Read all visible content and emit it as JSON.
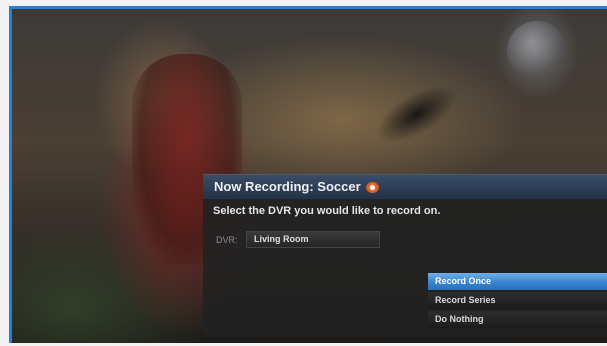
{
  "dialog": {
    "title": "Now Recording: Soccer",
    "title_icon": "record-icon",
    "instruction": "Select the DVR you would like to record on.",
    "dvr_label": "DVR:",
    "dvr_value": "Living Room"
  },
  "options": [
    {
      "label": "Record Once",
      "selected": true
    },
    {
      "label": "Record Series",
      "selected": false
    },
    {
      "label": "Do Nothing",
      "selected": false
    }
  ],
  "colors": {
    "frame_accent": "#2a7fd0",
    "selected_option": "#3a84cf",
    "record_icon": "#e86a2a"
  }
}
